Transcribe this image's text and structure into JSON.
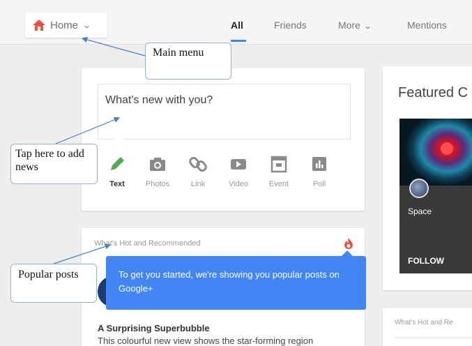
{
  "header": {
    "home_label": "Home",
    "tabs": [
      {
        "label": "All",
        "active": true
      },
      {
        "label": "Friends",
        "active": false
      },
      {
        "label": "More",
        "active": false
      },
      {
        "label": "Mentions",
        "active": false
      }
    ]
  },
  "compose": {
    "placeholder": "What's new with you?",
    "post_types": [
      "Text",
      "Photos",
      "Link",
      "Video",
      "Event",
      "Poll"
    ]
  },
  "hot": {
    "title": "What's Hot and Recommended",
    "tooltip": "To get you started, we're showing you popular posts on Google+",
    "post_title": "A Surprising Superbubble",
    "post_snippet": "This colourful new view shows the star-forming region"
  },
  "featured": {
    "title": "Featured C",
    "community_name": "Space",
    "follow_label": "FOLLOW"
  },
  "hot_right": {
    "title": "What's Hot and Re"
  },
  "callouts": {
    "main_menu": "Main menu",
    "tap_here": "Tap here to add news",
    "popular": "Popular posts"
  },
  "colors": {
    "accent": "#4285f4",
    "home_icon": "#e8553e",
    "text_icon": "#4caf50",
    "fire_icon": "#e8553e",
    "callout_border": "#8fb3d9"
  },
  "icons": [
    "home-icon",
    "chevron-down-icon",
    "pencil-icon",
    "camera-icon",
    "link-icon",
    "video-icon",
    "event-icon",
    "poll-icon",
    "fire-icon"
  ]
}
